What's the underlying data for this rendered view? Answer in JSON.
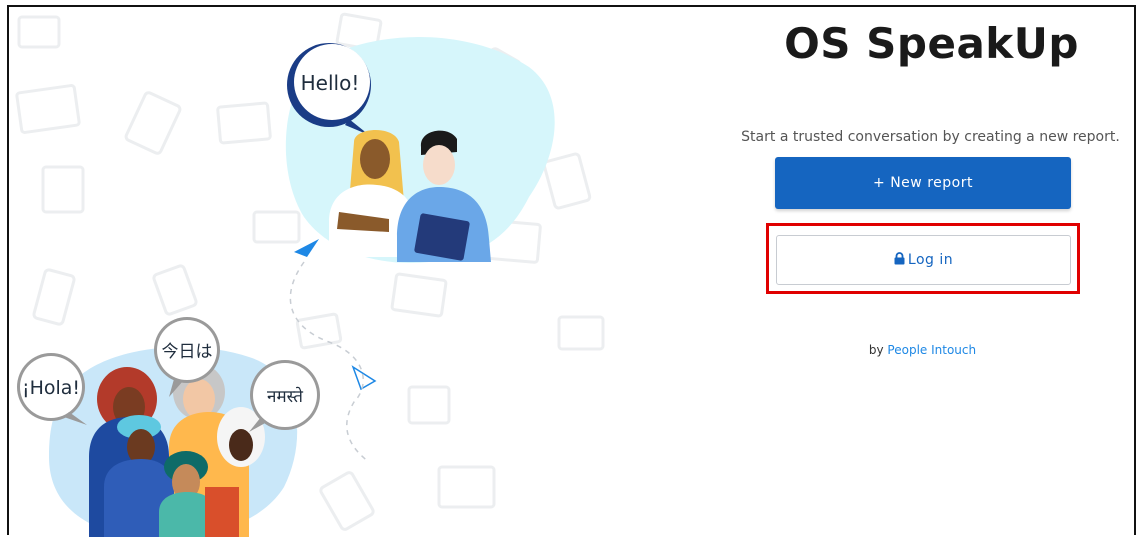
{
  "header": {
    "app_title": "OS SpeakUp"
  },
  "main": {
    "tagline": "Start a trusted conversation by creating a new report.",
    "new_report_label": "+ New report",
    "login_label": "Log in",
    "byline_prefix": "by ",
    "byline_link": "People Intouch"
  },
  "illustration": {
    "bubbles": {
      "hello": "Hello!",
      "hola": "¡Hola!",
      "konnichiwa": "今日は",
      "namaste": "नमस्ते"
    }
  },
  "icons": {
    "login": "lock-icon"
  },
  "colors": {
    "primary": "#1565c0",
    "link": "#1e88e5",
    "highlight": "#e00000",
    "blob_light_blue": "#d6f6fb"
  }
}
